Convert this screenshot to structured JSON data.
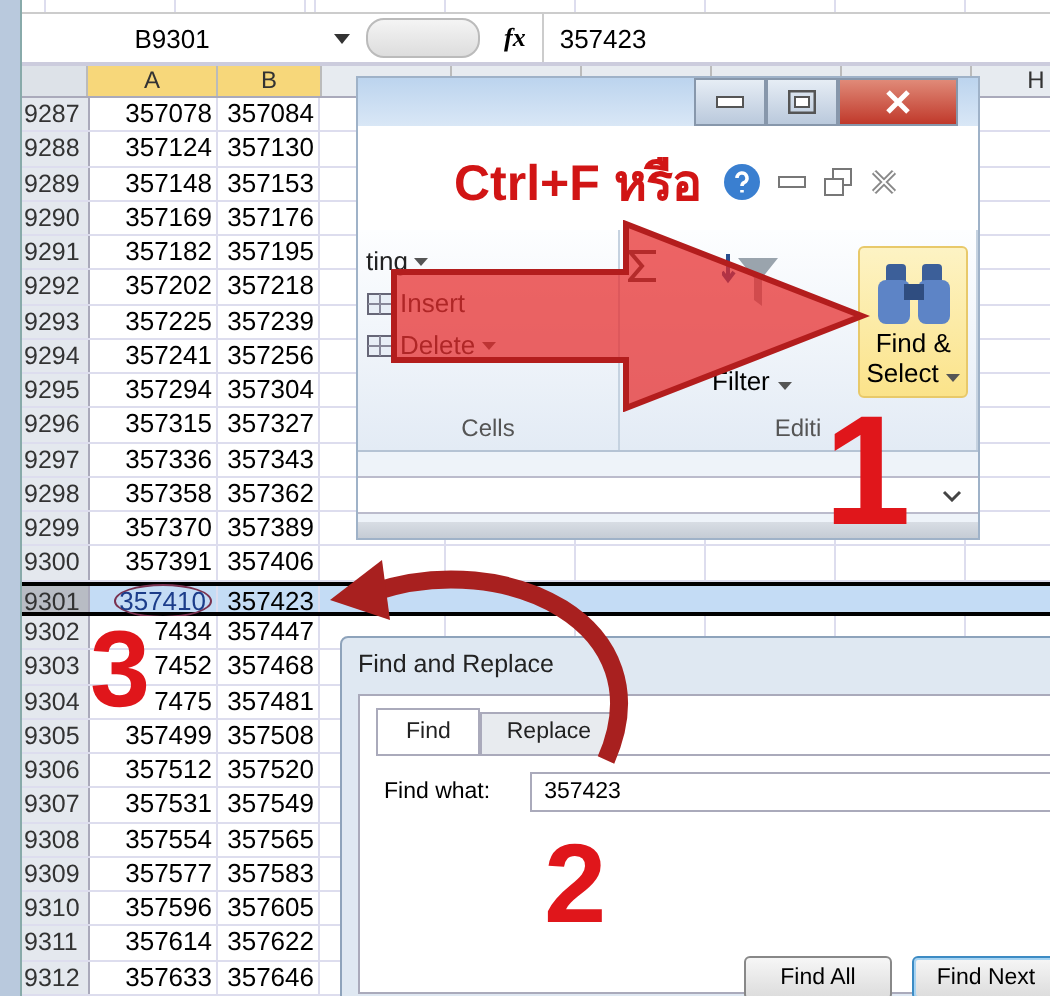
{
  "formula_bar": {
    "name_box": "B9301",
    "function_label": "fx",
    "value": "357423"
  },
  "columns": [
    {
      "label": "A",
      "kind": "a"
    },
    {
      "label": "B",
      "kind": "b"
    },
    {
      "label": "H",
      "kind": "far"
    }
  ],
  "rows": [
    {
      "num": "9287",
      "a": "357078",
      "b": "357084",
      "selected": false
    },
    {
      "num": "9288",
      "a": "357124",
      "b": "357130",
      "selected": false
    },
    {
      "num": "9289",
      "a": "357148",
      "b": "357153",
      "selected": false
    },
    {
      "num": "9290",
      "a": "357169",
      "b": "357176",
      "selected": false
    },
    {
      "num": "9291",
      "a": "357182",
      "b": "357195",
      "selected": false
    },
    {
      "num": "9292",
      "a": "357202",
      "b": "357218",
      "selected": false
    },
    {
      "num": "9293",
      "a": "357225",
      "b": "357239",
      "selected": false
    },
    {
      "num": "9294",
      "a": "357241",
      "b": "357256",
      "selected": false
    },
    {
      "num": "9295",
      "a": "357294",
      "b": "357304",
      "selected": false
    },
    {
      "num": "9296",
      "a": "357315",
      "b": "357327",
      "selected": false
    },
    {
      "num": "9297",
      "a": "357336",
      "b": "357343",
      "selected": false
    },
    {
      "num": "9298",
      "a": "357358",
      "b": "357362",
      "selected": false
    },
    {
      "num": "9299",
      "a": "357370",
      "b": "357389",
      "selected": false
    },
    {
      "num": "9300",
      "a": "357391",
      "b": "357406",
      "selected": false
    },
    {
      "num": "9301",
      "a": "357410",
      "b": "357423",
      "selected": true
    },
    {
      "num": "9302",
      "a": "7434",
      "b": "357447",
      "selected": false
    },
    {
      "num": "9303",
      "a": "7452",
      "b": "357468",
      "selected": false
    },
    {
      "num": "9304",
      "a": "7475",
      "b": "357481",
      "selected": false
    },
    {
      "num": "9305",
      "a": "357499",
      "b": "357508",
      "selected": false
    },
    {
      "num": "9306",
      "a": "357512",
      "b": "357520",
      "selected": false
    },
    {
      "num": "9307",
      "a": "357531",
      "b": "357549",
      "selected": false
    },
    {
      "num": "9308",
      "a": "357554",
      "b": "357565",
      "selected": false
    },
    {
      "num": "9309",
      "a": "357577",
      "b": "357583",
      "selected": false
    },
    {
      "num": "9310",
      "a": "357596",
      "b": "357605",
      "selected": false
    },
    {
      "num": "9311",
      "a": "357614",
      "b": "357622",
      "selected": false
    },
    {
      "num": "9312",
      "a": "357633",
      "b": "357646",
      "selected": false
    }
  ],
  "ribbon": {
    "shortcut_caption": "Ctrl+F หรือ",
    "cells_items": [
      {
        "label": "ting",
        "dropdown": true
      },
      {
        "label": "Insert",
        "dropdown": false
      },
      {
        "label": "Delete",
        "dropdown": true
      }
    ],
    "cells_group": "Cells",
    "sort_label": "Filter",
    "find_label_1": "Find &",
    "find_label_2": "Select",
    "editing_group": "Editi"
  },
  "steps": [
    "1",
    "2",
    "3"
  ],
  "dialog": {
    "title": "Find and Replace",
    "tabs": [
      {
        "label": "Find",
        "selected": true
      },
      {
        "label": "Replace",
        "selected": false
      }
    ],
    "field_label": "Find what:",
    "field_value": "357423",
    "buttons": [
      "Find All",
      "Find Next"
    ]
  }
}
